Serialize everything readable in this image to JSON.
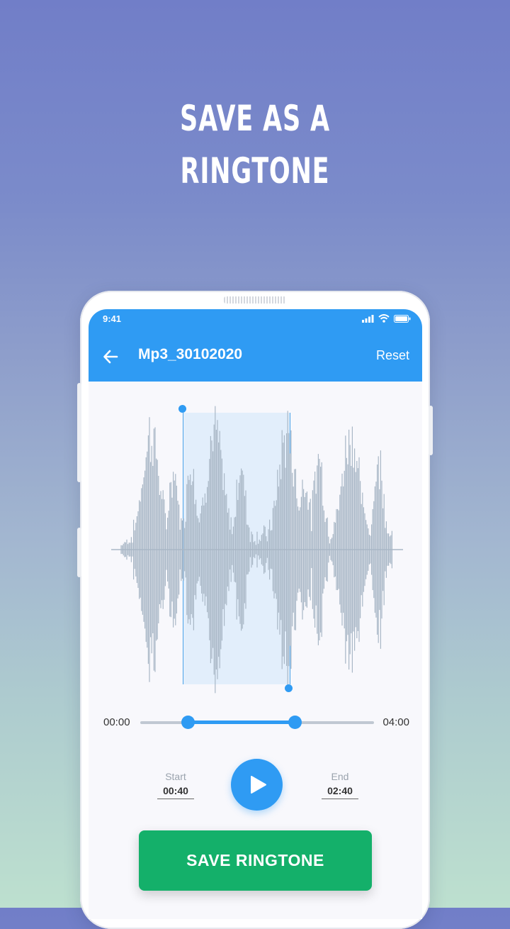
{
  "headline": {
    "line1": "SAVE AS A",
    "line2": "RINGTONE"
  },
  "status_bar": {
    "time": "9:41",
    "icons": [
      "signal-icon",
      "wifi-icon",
      "battery-icon"
    ]
  },
  "app_bar": {
    "title": "Mp3_30102020",
    "reset_label": "Reset",
    "back_icon": "arrow-left-icon"
  },
  "timeline": {
    "start_time": "00:00",
    "end_time": "04:00",
    "selection_start_fraction": 0.1667,
    "selection_end_fraction": 0.6667
  },
  "trim": {
    "start_label": "Start",
    "start_value": "00:40",
    "end_label": "End",
    "end_value": "02:40"
  },
  "play_icon": "play-icon",
  "save_button": {
    "label": "SAVE RINGTONE"
  },
  "colors": {
    "accent": "#2f9bf3",
    "save": "#14b06a",
    "wave": "#a9b7c6",
    "selection": "#deecfa"
  }
}
